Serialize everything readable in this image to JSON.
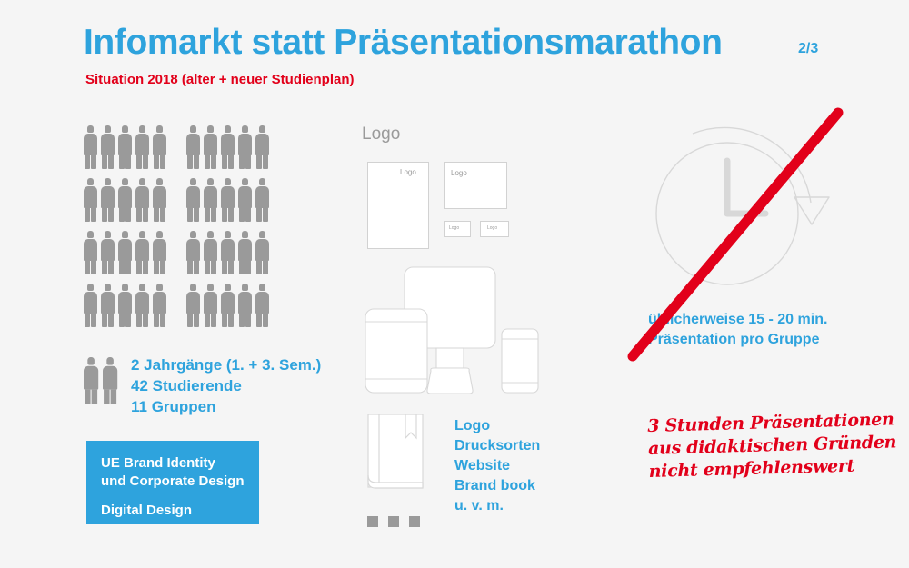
{
  "slide": {
    "title": "Infomarkt statt Präsentationsmarathon",
    "page_number": "2/3",
    "subtitle": "Situation 2018 (alter + neuer Studienplan)",
    "background_color": "#f5f5f5",
    "accent_blue": "#2ea3dd",
    "accent_red": "#e2001a",
    "icon_gray": "#9a9a9a"
  },
  "left_column": {
    "pictogram": {
      "rows": 4,
      "groups_per_row": 2,
      "people_per_group": 5,
      "extra_people": 2,
      "total_people": 42
    },
    "summary_lines": [
      "2 Jahrgänge (1. + 3. Sem.)",
      "42 Studierende",
      "11 Gruppen"
    ],
    "course_box": {
      "lines": [
        "UE Brand Identity",
        "und Corporate Design",
        "Digital Design"
      ]
    }
  },
  "middle_column": {
    "heading": "Logo",
    "wireframes": [
      {
        "name": "poster",
        "label": "Logo"
      },
      {
        "name": "card",
        "label": "Logo"
      },
      {
        "name": "chip-left",
        "label": "Logo"
      },
      {
        "name": "chip-right",
        "label": "Logo"
      }
    ],
    "devices": [
      "tablet",
      "desktop-monitor",
      "smartphone"
    ],
    "deliverables": [
      "Logo",
      "Drucksorten",
      "Website",
      "Brand book",
      "u. v. m."
    ],
    "dots_count": 3
  },
  "right_column": {
    "clock_caption_lines": [
      "üblicherweise 15 - 20 min.",
      "Präsentation pro Gruppe"
    ],
    "strikethrough": true,
    "handwritten_note_lines": [
      "3 Stunden Präsentationen",
      "aus didaktischen Gründen",
      "nicht empfehlenswert"
    ]
  }
}
